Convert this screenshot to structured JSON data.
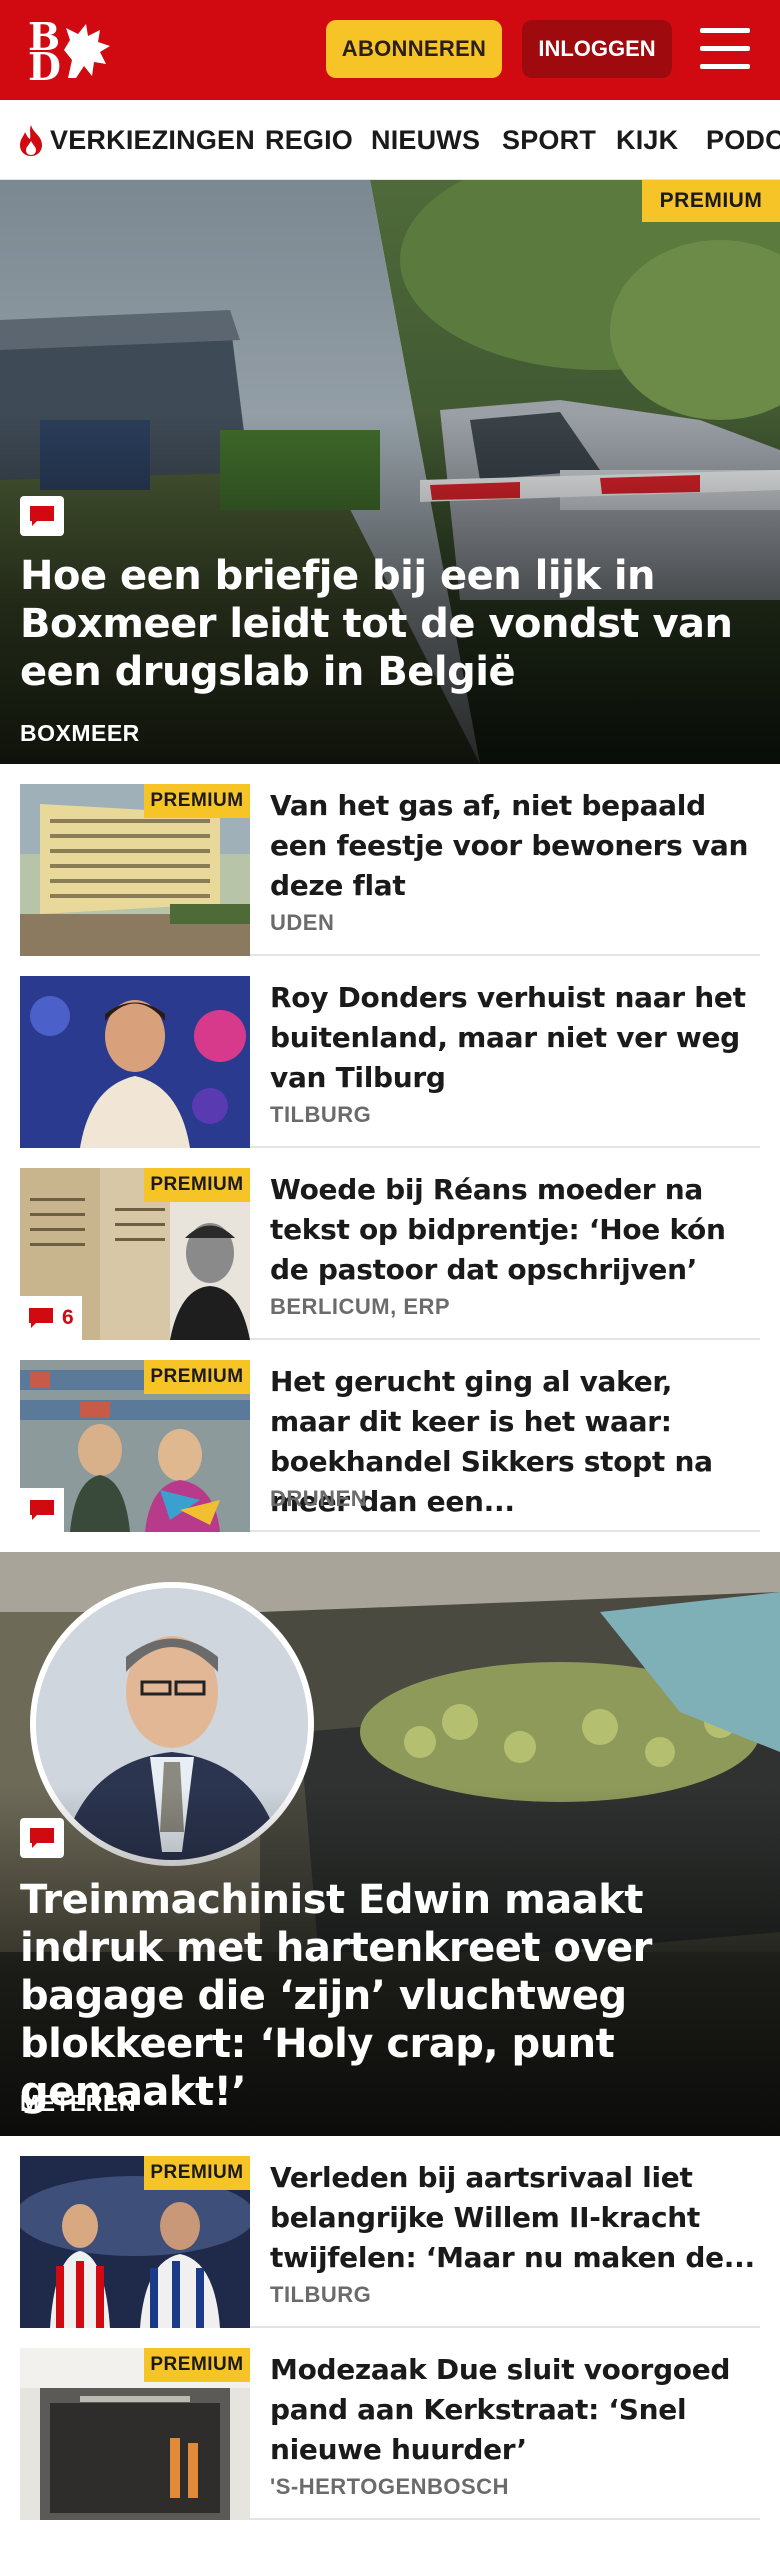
{
  "header": {
    "logo_alt": "BD",
    "subscribe_label": "ABONNEREN",
    "login_label": "INLOGGEN"
  },
  "nav": {
    "items": [
      "VERKIEZINGEN",
      "REGIO",
      "NIEUWS",
      "SPORT",
      "KIJK",
      "PODCAST"
    ]
  },
  "hero1": {
    "premium": "PREMIUM",
    "title": "Hoe een briefje bij een lijk in Boxmeer leidt tot de vondst van een drugslab in België",
    "place": "BOXMEER"
  },
  "articles1": [
    {
      "title": "Van het gas af, niet bepaald een feestje voor bewoners van deze flat",
      "place": "UDEN",
      "premium": "PREMIUM"
    },
    {
      "title": "Roy Donders verhuist naar het buitenland, maar niet ver weg van Tilburg",
      "place": "TILBURG"
    },
    {
      "title": "Woede bij Réans moeder na tekst op bidprentje: ‘Hoe kón de pastoor dat opschrijven’",
      "place": "BERLICUM, ERP",
      "premium": "PREMIUM",
      "comments": "6"
    },
    {
      "title": "Het gerucht ging al vaker, maar dit keer is het waar: boekhandel Sikkers stopt na meer dan een...",
      "place": "DRUNEN",
      "premium": "PREMIUM"
    }
  ],
  "hero2": {
    "title": "Treinmachinist Edwin maakt indruk met hartenkreet over bagage die ‘zijn’ vluchtweg blokkeert: ‘Holy crap, punt gemaakt!’",
    "place": "METEREN"
  },
  "articles2": [
    {
      "title": "Verleden bij aartsrivaal liet belangrijke Willem II-kracht twijfelen: ‘Maar nu maken de...",
      "place": "TILBURG",
      "premium": "PREMIUM"
    },
    {
      "title": "Modezaak Due sluit voorgoed pand aan Kerkstraat: ‘Snel nieuwe huurder’",
      "place": "'S-HERTOGENBOSCH",
      "premium": "PREMIUM"
    }
  ],
  "colors": {
    "brand": "#d10a11",
    "premium": "#f7c428",
    "login": "#9e0a0e"
  }
}
